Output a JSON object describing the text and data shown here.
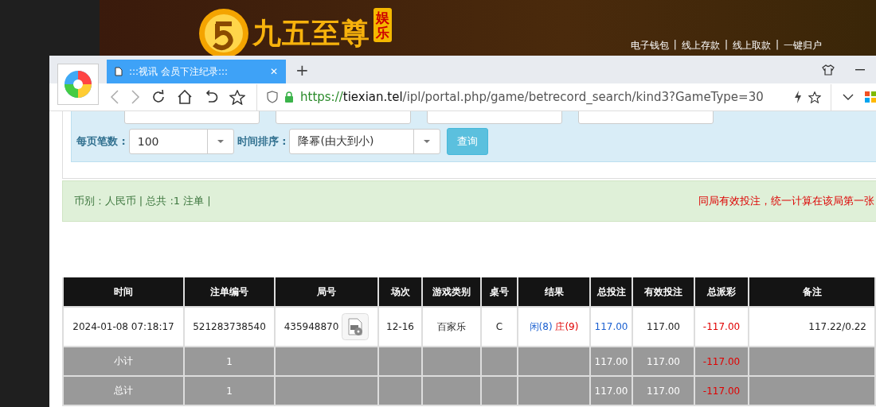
{
  "banner": {
    "logo_text": "九五至尊",
    "badge": "娱乐",
    "nav_links": [
      {
        "label": "电子钱包"
      },
      {
        "label": "线上存款"
      },
      {
        "label": "线上取款"
      },
      {
        "label": "一键归户"
      }
    ],
    "separator": "|"
  },
  "browser": {
    "tabs": [
      {
        "title": ":::视讯 会员下注纪录:::",
        "selected": true,
        "close": "✕"
      }
    ],
    "new_tab": "+",
    "url": {
      "scheme": "https://",
      "domain": "tiexian.tel",
      "path": "/ipl/portal.php/game/betrecord_search/kind3?GameType=30"
    }
  },
  "filters": {
    "per_page": {
      "label": "每页笔数 :",
      "value": "100"
    },
    "sort": {
      "label": "时间排序 :",
      "value": "降幂(由大到小)"
    },
    "button": "查询"
  },
  "summary": {
    "left": "币别 : 人民币 | 总共 :1 注单 |",
    "notice": "同局有效投注，统一计算在该局第一张"
  },
  "table": {
    "columns": [
      "时间",
      "注单编号",
      "局号",
      "场次",
      "游戏类别",
      "桌号",
      "结果",
      "总投注",
      "有效投注",
      "总派彩",
      "备注"
    ],
    "rows": [
      {
        "kind": "detail",
        "cells": [
          "2024-01-08 07:18:17",
          "521283738540",
          "435948870",
          "12-16",
          "百家乐",
          "C",
          "",
          "117.00",
          "117.00",
          "-117.00",
          "117.22/0.22"
        ],
        "result": [
          {
            "text": "闲(8)",
            "color": "#1a5fd0"
          },
          {
            "text": "庄(9)",
            "color": "#e00000"
          }
        ]
      },
      {
        "kind": "subtotal",
        "cells": [
          "小计",
          "1",
          "",
          "",
          "",
          "",
          "",
          "117.00",
          "117.00",
          "-117.00",
          ""
        ]
      },
      {
        "kind": "subtotal",
        "cells": [
          "总计",
          "1",
          "",
          "",
          "",
          "",
          "",
          "117.00",
          "117.00",
          "-117.00",
          ""
        ]
      }
    ]
  }
}
